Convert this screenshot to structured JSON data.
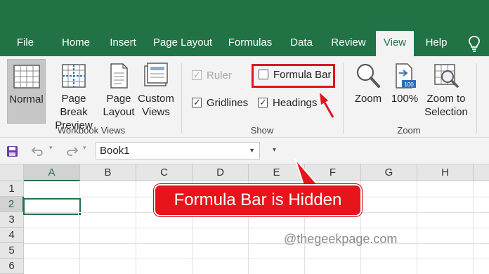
{
  "tabs": [
    {
      "label": "File",
      "active": false
    },
    {
      "label": "Home",
      "active": false
    },
    {
      "label": "Insert",
      "active": false
    },
    {
      "label": "Page Layout",
      "active": false
    },
    {
      "label": "Formulas",
      "active": false
    },
    {
      "label": "Data",
      "active": false
    },
    {
      "label": "Review",
      "active": false
    },
    {
      "label": "View",
      "active": true
    },
    {
      "label": "Help",
      "active": false
    }
  ],
  "workbook_views": {
    "group_label": "Workbook Views",
    "normal": "Normal",
    "page_break_line1": "Page Break",
    "page_break_line2": "Preview",
    "page_layout_line1": "Page",
    "page_layout_line2": "Layout",
    "custom_line1": "Custom",
    "custom_line2": "Views"
  },
  "show": {
    "group_label": "Show",
    "ruler": {
      "label": "Ruler",
      "checked": true,
      "enabled": false
    },
    "formula_bar": {
      "label": "Formula Bar",
      "checked": false,
      "enabled": true
    },
    "gridlines": {
      "label": "Gridlines",
      "checked": true,
      "enabled": true
    },
    "headings": {
      "label": "Headings",
      "checked": true,
      "enabled": true
    }
  },
  "zoom": {
    "group_label": "Zoom",
    "zoom": "Zoom",
    "hundred": "100%",
    "hundred_icon_text": "100",
    "to_selection_line1": "Zoom to",
    "to_selection_line2": "Selection"
  },
  "quick_access": {
    "name_box": "Book1"
  },
  "grid": {
    "columns": [
      "A",
      "B",
      "C",
      "D",
      "E",
      "F",
      "G",
      "H"
    ],
    "rows": [
      "1",
      "2",
      "3",
      "4",
      "5",
      "6"
    ],
    "active_cell": "A2"
  },
  "annotation": {
    "callout": "Formula Bar is Hidden",
    "watermark": "@thegeekpage.com"
  },
  "colors": {
    "ribbon_green": "#217346",
    "highlight_red": "#e0151c"
  }
}
